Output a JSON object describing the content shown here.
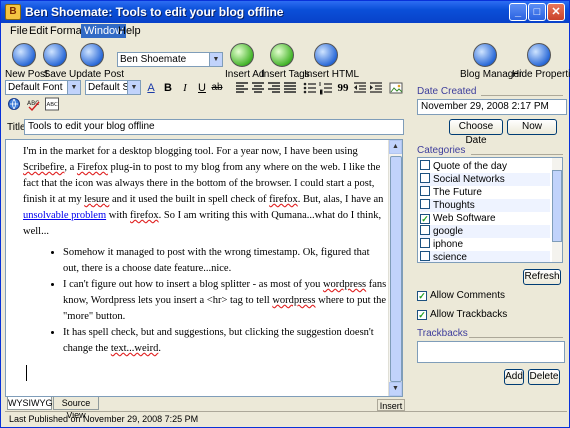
{
  "window": {
    "title": "Ben Shoemate: Tools to edit your blog offline",
    "minimize_glyph": "_",
    "maximize_glyph": "□",
    "close_glyph": "✕",
    "app_icon_glyph": "B"
  },
  "menu": [
    "File",
    "Edit",
    "Format",
    "Window",
    "Help"
  ],
  "toolbar": {
    "new_post": "New Post",
    "save": "Save",
    "update_post": "Update Post",
    "blog_select": "Ben Shoemate",
    "insert_ad": "Insert Ad",
    "insert_tags": "Insert Tags",
    "insert_html": "Insert HTML",
    "blog_manager": "Blog Manager",
    "hide_properties": "Hide Properties"
  },
  "format_bar": {
    "font": "Default Font",
    "size": "Default Size",
    "bold_glyph": "B",
    "italic_glyph": "I",
    "underline_glyph": "U",
    "strike_glyph": "ab",
    "color_glyph": "A",
    "quote_glyph": "99"
  },
  "post": {
    "title_label": "Title:",
    "title_value": "Tools to edit your blog offline",
    "para_1": "I'm in the market for a desktop blogging tool. For a year now, I have been using",
    "para_2_a": "Scribefire",
    "para_2_b": ", a ",
    "para_2_c": "Firefox",
    "para_2_d": " plug-in to post to my blog from any where on the web. I like the fact that the icon was always there in the bottom of the browser. I could start a post, finish it at my ",
    "para_2_e": "lesure",
    "para_2_f": " and it used the built in spell check of ",
    "para_2_g": "firefox",
    "para_2_h": ". But, alas, I have an ",
    "para_2_link": "unsolvable problem",
    "para_2_i": " with ",
    "para_2_j": "firefox",
    "para_2_k": ". So I am writing this with Qumana...what do I think, well...",
    "bullet_1": "Somehow it managed to post with the wrong timestamp. Ok, figured that out, there is a choose date feature...nice.",
    "bullet_2_a": "I can't figure out how to insert a blog splitter - as most of you ",
    "bullet_2_b": "wordpress",
    "bullet_2_c": " fans know, Wordpress lets you insert a <hr> tag to tell ",
    "bullet_2_d": "wordpress",
    "bullet_2_e": " where to put the \"more\" button.",
    "bullet_3_a": "It has spell check, but and suggestions, but clicking the suggestion doesn't change the ",
    "bullet_3_b": "text...weird",
    "bullet_3_c": "."
  },
  "editor_tabs": {
    "wysiwyg": "WYSIWYG",
    "source": "Source View",
    "mode": "Insert"
  },
  "status": "Last Published on November 29, 2008 7:25 PM",
  "sidebar": {
    "date_created_label": "Date Created",
    "date_value": "November 29, 2008 2:17 PM",
    "choose_date": "Choose Date",
    "now": "Now",
    "categories_label": "Categories",
    "categories": [
      {
        "name": "Quote of the day",
        "checked": false
      },
      {
        "name": "Social Networks",
        "checked": false
      },
      {
        "name": "The Future",
        "checked": false
      },
      {
        "name": "Thoughts",
        "checked": false
      },
      {
        "name": "Web Software",
        "checked": true
      },
      {
        "name": "google",
        "checked": false
      },
      {
        "name": "iphone",
        "checked": false
      },
      {
        "name": "science",
        "checked": false
      }
    ],
    "refresh": "Refresh",
    "allow_comments": "Allow Comments",
    "allow_trackbacks": "Allow Trackbacks",
    "trackbacks_label": "Trackbacks",
    "add": "Add",
    "delete": "Delete",
    "check_glyph": "✓"
  },
  "colors": {
    "titlebar": "#0a4fd8",
    "accent": "#316ac5",
    "link": "#0000ee",
    "spell_error": "#e02020"
  }
}
